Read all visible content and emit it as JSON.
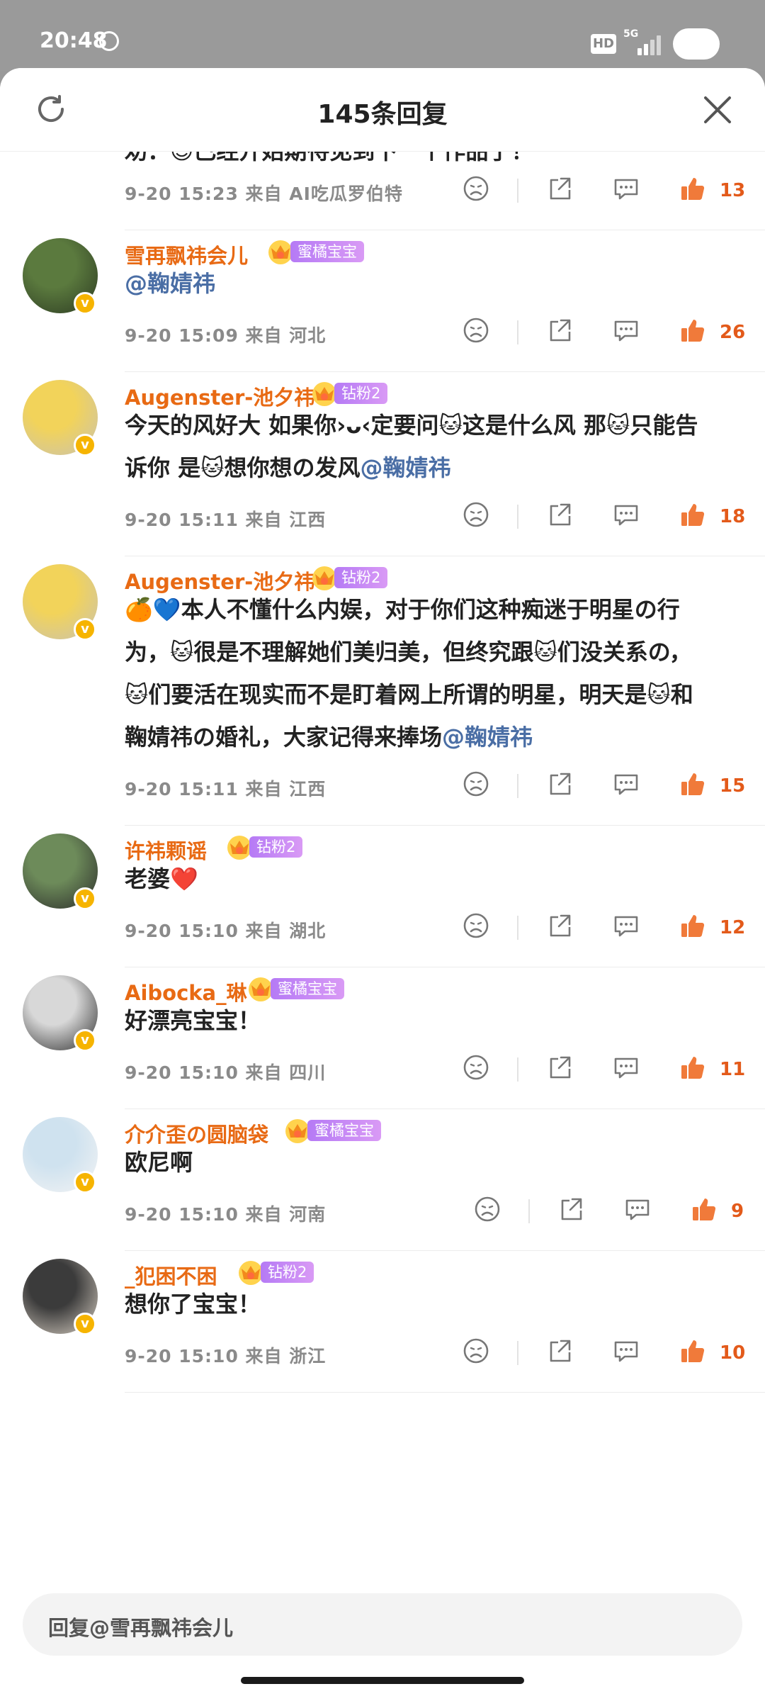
{
  "status_bar": {
    "time": "20:48",
    "hd": "HD",
    "network": "5G"
  },
  "header": {
    "title": "145条回复"
  },
  "top_partial": {
    "text": "劝：😊已经开始期待见到下一个作品了！",
    "time": "9-20  15:23  来自  AI吃瓜罗伯特",
    "likes": "13"
  },
  "comments": [
    {
      "name": "雪再飘祎会儿",
      "badge": "蜜橘宝宝",
      "content_lines": [
        ""
      ],
      "mention": "@鞠婧祎",
      "time": "9-20  15:09  来自  河北",
      "likes": "26"
    },
    {
      "name": "Augenster-池夕祎",
      "badge": "钻粉2",
      "content_lines": [
        "今天的风好大  如果你›ᴗ‹定要问🐱这是什么风  那🐱只能告",
        "诉你  是🐱想你想の发风"
      ],
      "mention": "@鞠婧祎",
      "time": "9-20  15:11  来自  江西",
      "likes": "18"
    },
    {
      "name": "Augenster-池夕祎",
      "badge": "钻粉2",
      "content_lines": [
        "🍊💙本人不懂什么内娱，对于你们这种痴迷于明星の行",
        "为，🐱很是不理解她们美归美，但终究跟🐱们没关系の，",
        "🐱们要活在现实而不是盯着网上所谓的明星，明天是🐱和",
        "鞠婧祎の婚礼，大家记得来捧场"
      ],
      "mention": "@鞠婧祎",
      "time": "9-20  15:11  来自  江西",
      "likes": "15"
    },
    {
      "name": "许祎颗谣",
      "badge": "钻粉2",
      "content_lines": [
        "老婆❤️"
      ],
      "mention": "",
      "time": "9-20  15:10  来自  湖北",
      "likes": "12"
    },
    {
      "name": "Aibocka_琳",
      "badge": "蜜橘宝宝",
      "content_lines": [
        "好漂亮宝宝！"
      ],
      "mention": "",
      "time": "9-20  15:10  来自  四川",
      "likes": "11"
    },
    {
      "name": "介介歪の圆脑袋",
      "badge": "蜜橘宝宝",
      "content_lines": [
        "欧尼啊"
      ],
      "mention": "",
      "time": "9-20  15:10  来自  河南",
      "likes": "9"
    },
    {
      "name": "_犯困不困",
      "badge": "钻粉2",
      "content_lines": [
        "想你了宝宝！"
      ],
      "mention": "",
      "time": "9-20  15:10  来自  浙江",
      "likes": "10"
    }
  ],
  "reply_bar": {
    "placeholder": "回复@雪再飘祎会儿"
  },
  "colors": {
    "accent": "#e86a14",
    "like": "#f07a3a",
    "mention": "#4a6ea5",
    "badge": "#c08af5"
  },
  "icons": [
    "refresh-icon",
    "close-icon",
    "dislike-icon",
    "share-icon",
    "comment-icon",
    "like-icon",
    "crown-icon",
    "verified-icon"
  ]
}
